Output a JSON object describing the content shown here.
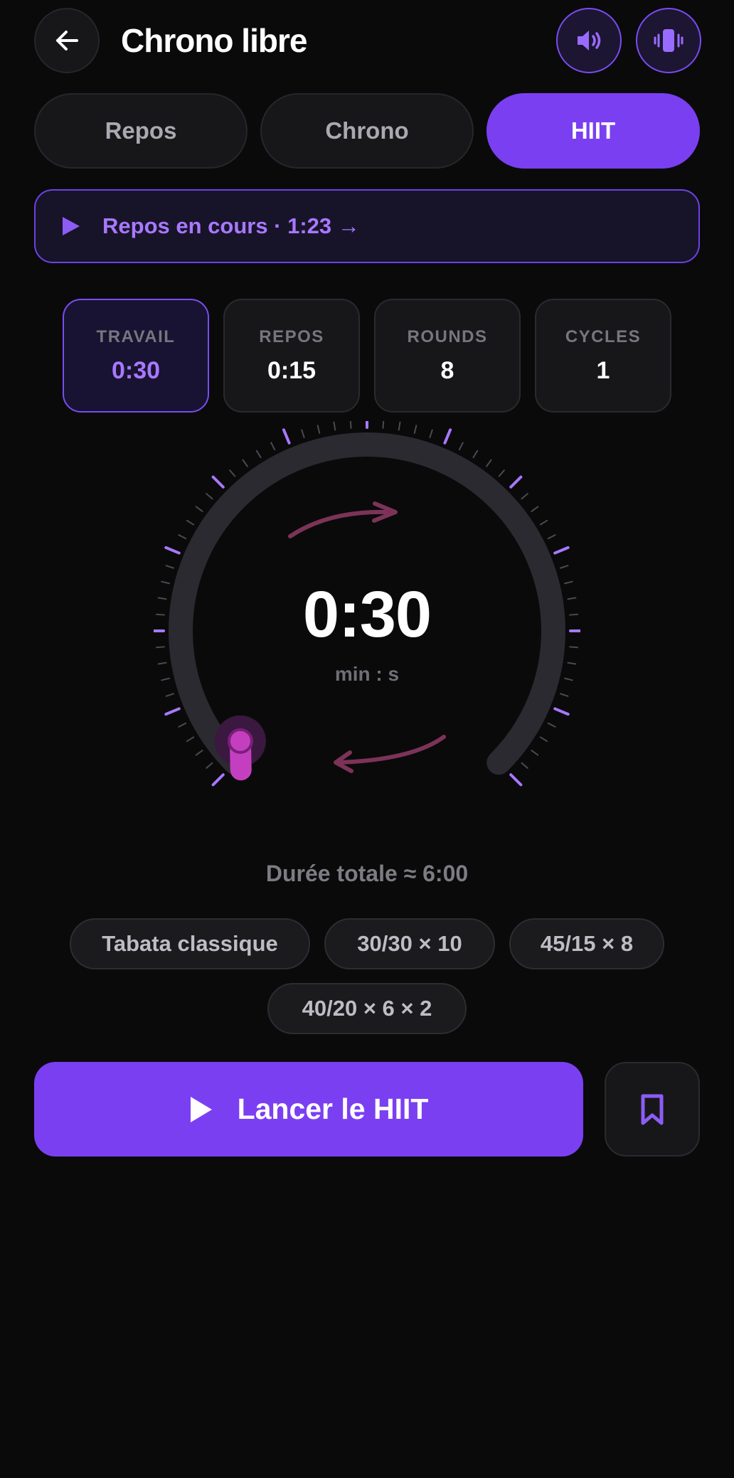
{
  "header": {
    "title": "Chrono libre",
    "back_icon": "arrow-left-icon",
    "sound_icon": "speaker-icon",
    "vibrate_icon": "vibrate-icon"
  },
  "tabs": [
    {
      "label": "Repos",
      "active": false
    },
    {
      "label": "Chrono",
      "active": false
    },
    {
      "label": "HIIT",
      "active": true
    }
  ],
  "banner": {
    "text": "Repos en cours · 1:23 →",
    "icon": "play-icon"
  },
  "params": [
    {
      "label": "TRAVAIL",
      "value": "0:30",
      "active": true
    },
    {
      "label": "REPOS",
      "value": "0:15",
      "active": false
    },
    {
      "label": "ROUNDS",
      "value": "8",
      "active": false
    },
    {
      "label": "CYCLES",
      "value": "1",
      "active": false
    }
  ],
  "dial": {
    "time": "0:30",
    "unit": "min : s",
    "level": 0
  },
  "total": "Durée totale ≈ 6:00",
  "presets": [
    "Tabata classique",
    "30/30 × 10",
    "45/15 × 8",
    "40/20 × 6 × 2"
  ],
  "launch": {
    "label": "Lancer le HIIT",
    "icon": "play-icon"
  },
  "bookmark_icon": "bookmark-icon",
  "colors": {
    "accent": "#7b3ff2",
    "accent_light": "#a878ff",
    "knob": "#c43fc0",
    "arrows": "#7c3357",
    "background": "#0a0a0b"
  }
}
